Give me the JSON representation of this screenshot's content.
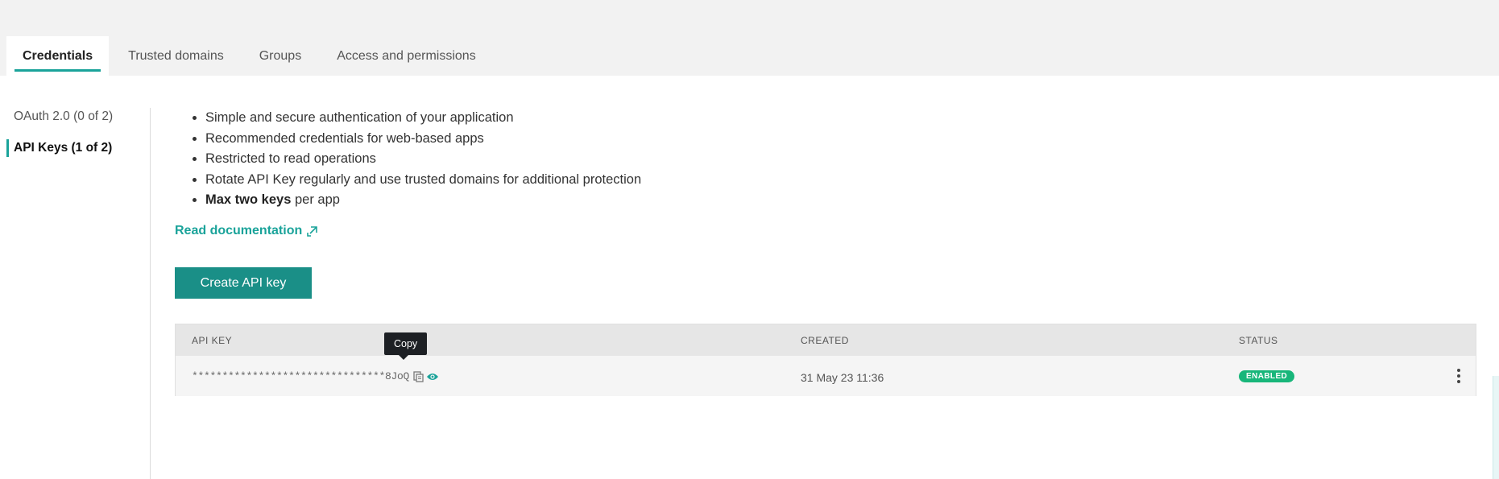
{
  "tabs": [
    {
      "label": "Credentials"
    },
    {
      "label": "Trusted domains"
    },
    {
      "label": "Groups"
    },
    {
      "label": "Access and permissions"
    }
  ],
  "sidebar": {
    "items": [
      {
        "label": "OAuth 2.0 (0 of 2)"
      },
      {
        "label": "API Keys (1 of 2)"
      }
    ]
  },
  "content": {
    "bullets": [
      "Simple and secure authentication of your application",
      "Recommended credentials for web-based apps",
      "Restricted to read operations",
      "Rotate API Key regularly and use trusted domains for additional protection"
    ],
    "last_bullet_bold": "Max two keys",
    "last_bullet_rest": " per app",
    "doc_link": "Read documentation",
    "create_button": "Create API key"
  },
  "table": {
    "headers": {
      "api_key": "API KEY",
      "created": "CREATED",
      "status": "STATUS"
    },
    "rows": [
      {
        "api_key": "********************************8JoQ",
        "created": "31 May 23 11:36",
        "status": "ENABLED"
      }
    ]
  },
  "tooltip": "Copy",
  "colors": {
    "accent": "#1aa39a",
    "button": "#1a8f87",
    "status_enabled": "#18b67a"
  },
  "icons": {
    "doc_link": "external-link-icon",
    "copy": "copy-icon",
    "reveal": "eye-icon",
    "menu": "kebab-menu-icon"
  }
}
